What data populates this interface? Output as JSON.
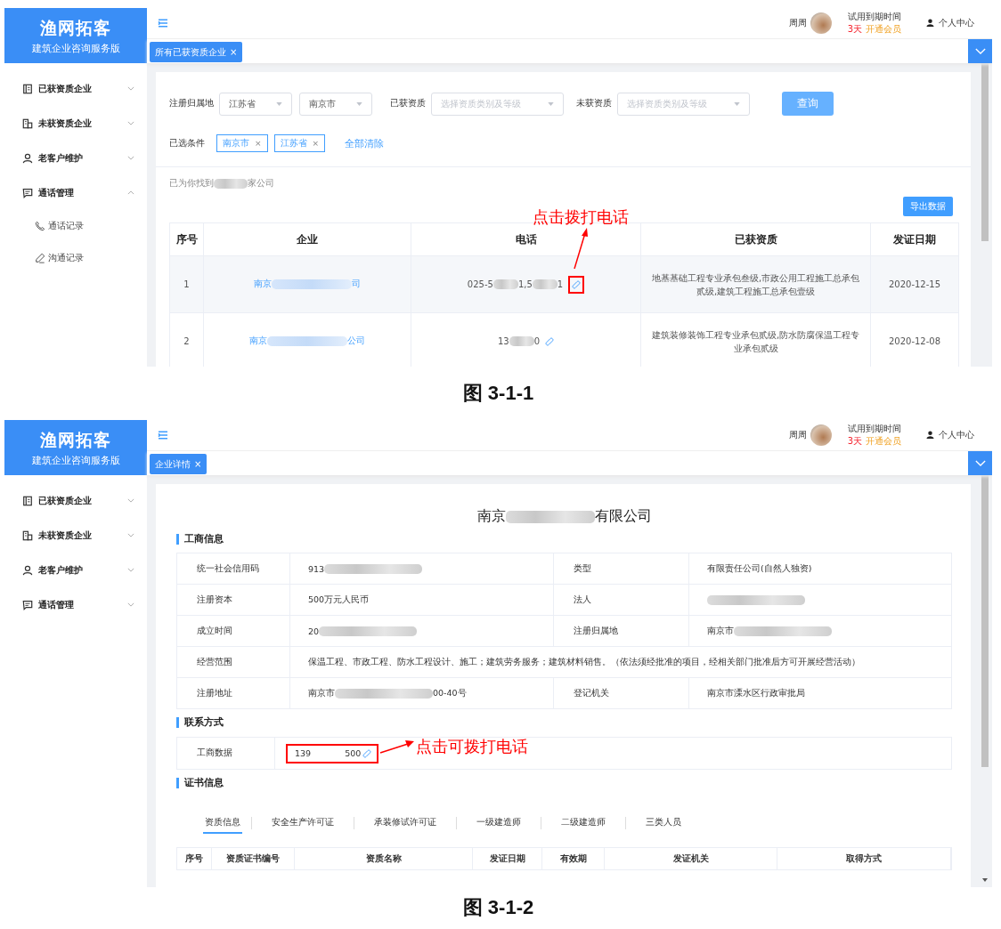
{
  "figures": [
    {
      "kind": "search",
      "shell": {
        "logo_title": "渔网拓客",
        "logo_subtitle": "建筑企业咨询服务版",
        "menu": [
          {
            "label": "已获资质企业",
            "expanded": false
          },
          {
            "label": "未获资质企业",
            "expanded": false
          },
          {
            "label": "老客户维护",
            "expanded": false
          },
          {
            "label": "通话管理",
            "expanded": true,
            "children": [
              {
                "label": "通话记录"
              },
              {
                "label": "沟通记录"
              }
            ]
          }
        ],
        "user_name": "周周",
        "trial_label": "试用到期时间",
        "trial_days": "3天",
        "upgrade_link": "开通会员",
        "profile_link": "个人中心",
        "tabs": [
          {
            "label": "所有已获资质企业",
            "close": "×",
            "selected": true
          }
        ]
      },
      "filter": {
        "region_label": "注册归属地",
        "province": "江苏省",
        "city": "南京市",
        "have_label": "已获资质",
        "have_placeholder": "选择资质类别及等级",
        "lack_label": "未获资质",
        "lack_placeholder": "选择资质类别及等级",
        "query_button": "查询"
      },
      "chips": {
        "label": "已选条件",
        "items": [
          {
            "text": "南京市",
            "close": "×"
          },
          {
            "text": "江苏省",
            "close": "×"
          }
        ],
        "clear": "全部清除"
      },
      "result": [
        {
          "kind": "text",
          "text": "已为你找到"
        },
        {
          "kind": "blur"
        },
        {
          "kind": "text",
          "text": "家公司"
        }
      ],
      "export_button": "导出数据",
      "table": {
        "columns": [
          "序号",
          "企业",
          "电话",
          "已获资质",
          "发证日期"
        ],
        "rows": [
          {
            "highlighted": true,
            "annotated": true,
            "index": "1",
            "company": [
              {
                "kind": "text",
                "text": "南京"
              },
              {
                "kind": "blur"
              },
              {
                "kind": "text",
                "text": "司"
              }
            ],
            "phone": [
              {
                "kind": "text",
                "text": "025-5"
              },
              {
                "kind": "blur"
              },
              {
                "kind": "text",
                "text": "1,5"
              },
              {
                "kind": "blur"
              },
              {
                "kind": "text",
                "text": "1"
              }
            ],
            "qualification": "地基基础工程专业承包叁级,市政公用工程施工总承包贰级,建筑工程施工总承包壹级",
            "date": "2020-12-15"
          },
          {
            "highlighted": false,
            "annotated": false,
            "index": "2",
            "company": [
              {
                "kind": "text",
                "text": "南京"
              },
              {
                "kind": "blur"
              },
              {
                "kind": "text",
                "text": "公司"
              }
            ],
            "phone": [
              {
                "kind": "text",
                "text": "13"
              },
              {
                "kind": "blur"
              },
              {
                "kind": "text",
                "text": "0"
              }
            ],
            "qualification": "建筑装修装饰工程专业承包贰级,防水防腐保温工程专业承包贰级",
            "date": "2020-12-08"
          }
        ]
      },
      "annotation": "点击拨打电话",
      "caption": "图 3-1-1"
    },
    {
      "kind": "detail",
      "shell": {
        "logo_title": "渔网拓客",
        "logo_subtitle": "建筑企业咨询服务版",
        "menu": [
          {
            "label": "已获资质企业",
            "expanded": false
          },
          {
            "label": "未获资质企业",
            "expanded": false
          },
          {
            "label": "老客户维护",
            "expanded": false
          },
          {
            "label": "通话管理",
            "expanded": false
          }
        ],
        "user_name": "周周",
        "trial_label": "试用到期时间",
        "trial_days": "3天",
        "upgrade_link": "开通会员",
        "profile_link": "个人中心",
        "tabs": [
          {
            "label": "企业详情",
            "close": "×",
            "selected": true
          }
        ]
      },
      "company_title": [
        {
          "kind": "text",
          "text": "南京"
        },
        {
          "kind": "blur"
        },
        {
          "kind": "text",
          "text": "有限公司"
        }
      ],
      "business_info": {
        "title": "工商信息",
        "rows": [
          {
            "cells": [
              {
                "label": "统一社会信用码",
                "value": [
                  {
                    "kind": "text",
                    "text": "913"
                  },
                  {
                    "kind": "blur"
                  }
                ]
              },
              {
                "label": "类型",
                "value": [
                  {
                    "kind": "text",
                    "text": "有限责任公司(自然人独资)"
                  }
                ]
              }
            ]
          },
          {
            "cells": [
              {
                "label": "注册资本",
                "value": [
                  {
                    "kind": "text",
                    "text": "500万元人民币"
                  }
                ]
              },
              {
                "label": "法人",
                "value": [
                  {
                    "kind": "blur"
                  }
                ]
              }
            ]
          },
          {
            "cells": [
              {
                "label": "成立时间",
                "value": [
                  {
                    "kind": "text",
                    "text": "20"
                  },
                  {
                    "kind": "blur"
                  }
                ]
              },
              {
                "label": "注册归属地",
                "value": [
                  {
                    "kind": "text",
                    "text": "南京市"
                  },
                  {
                    "kind": "blur"
                  }
                ]
              }
            ]
          },
          {
            "cells": [
              {
                "label": "经营范围",
                "value": [
                  {
                    "kind": "text",
                    "text": "保温工程、市政工程、防水工程设计、施工；建筑劳务服务；建筑材料销售。（依法须经批准的项目，经相关部门批准后方可开展经营活动）"
                  }
                ]
              }
            ]
          },
          {
            "cells": [
              {
                "label": "注册地址",
                "value": [
                  {
                    "kind": "text",
                    "text": "南京市"
                  },
                  {
                    "kind": "blur"
                  },
                  {
                    "kind": "text",
                    "text": "00-40号"
                  }
                ]
              },
              {
                "label": "登记机关",
                "value": [
                  {
                    "kind": "text",
                    "text": "南京市溧水区行政审批局"
                  }
                ]
              }
            ]
          }
        ]
      },
      "contact": {
        "title": "联系方式",
        "label": "工商数据",
        "phone": [
          {
            "kind": "text",
            "text": "139"
          },
          {
            "kind": "blank"
          },
          {
            "kind": "text",
            "text": "500"
          }
        ],
        "annotation": "点击可拨打电话"
      },
      "certificates": {
        "title": "证书信息",
        "tabs": [
          {
            "label": "资质信息",
            "selected": true
          },
          {
            "label": "安全生产许可证",
            "selected": false
          },
          {
            "label": "承装修试许可证",
            "selected": false
          },
          {
            "label": "一级建造师",
            "selected": false
          },
          {
            "label": "二级建造师",
            "selected": false
          },
          {
            "label": "三类人员",
            "selected": false
          }
        ],
        "columns": [
          "序号",
          "资质证书编号",
          "资质名称",
          "发证日期",
          "有效期",
          "发证机关",
          "取得方式"
        ]
      },
      "caption": "图 3-1-2"
    }
  ]
}
